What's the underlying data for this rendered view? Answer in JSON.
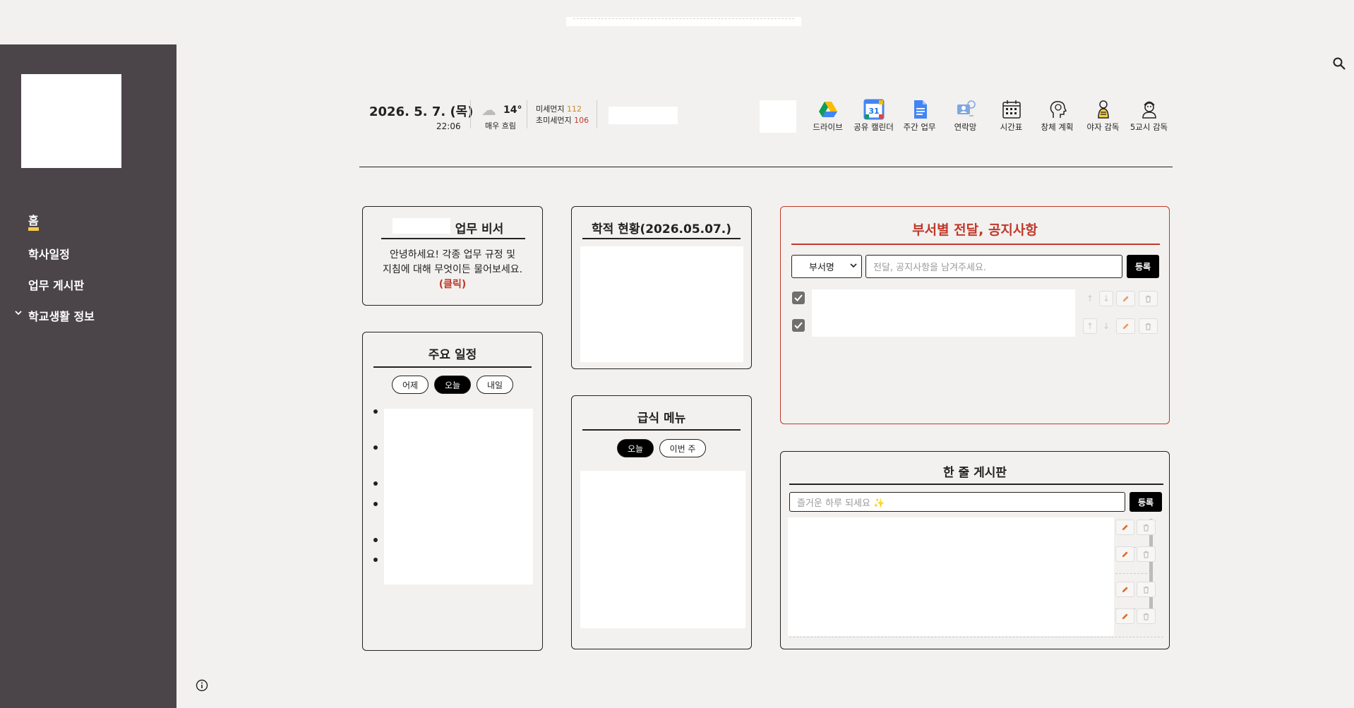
{
  "colors": {
    "sidebar": "#4b4549",
    "accent_yellow": "#f5cc4b",
    "notice_red": "#c0392b",
    "background": "#f2f1ef"
  },
  "sidebar": {
    "items": [
      {
        "label": "홈",
        "active": true
      },
      {
        "label": "학사일정"
      },
      {
        "label": "업무 게시판"
      },
      {
        "label": "학교생활 정보",
        "icon": "chevron-down-icon"
      }
    ]
  },
  "header": {
    "date": "2026. 5. 7. (목)",
    "time": "22:06",
    "weather": {
      "icon": "cloud-icon",
      "temp": "14°",
      "desc": "매우 흐림"
    },
    "dust": {
      "pm10_label": "미세먼지",
      "pm10_value": "112",
      "pm25_label": "초미세먼지",
      "pm25_value": "106"
    },
    "tools": [
      {
        "label": "드라이브",
        "icon": "google-drive-icon"
      },
      {
        "label": "공유 캘린더",
        "icon": "google-calendar-icon"
      },
      {
        "label": "주간 업무",
        "icon": "google-docs-icon"
      },
      {
        "label": "연락망",
        "icon": "contacts-icon"
      },
      {
        "label": "시간표",
        "icon": "timetable-icon"
      },
      {
        "label": "창체 계획",
        "icon": "brain-head-icon"
      },
      {
        "label": "야자 감독",
        "icon": "night-study-icon"
      },
      {
        "label": "5교시 감독",
        "icon": "supervisor-icon"
      }
    ],
    "calendar_number": "31"
  },
  "assistant": {
    "title": "업무 비서",
    "line1": "안녕하세요! 각종 업무 규정 및",
    "line2": "지침에 대해 무엇이든 물어보세요.",
    "link": "(클릭)"
  },
  "schedule": {
    "title": "주요 일정",
    "tabs": [
      {
        "label": "어제"
      },
      {
        "label": "오늘",
        "active": true
      },
      {
        "label": "내일"
      }
    ]
  },
  "enrollment": {
    "title": "학적 현황(2026.05.07.)"
  },
  "meal": {
    "title": "급식 메뉴",
    "tabs": [
      {
        "label": "오늘",
        "active": true
      },
      {
        "label": "이번 주"
      }
    ]
  },
  "notice": {
    "title": "부서별 전달, 공지사항",
    "select_value": "부서명",
    "input_placeholder": "전달, 공지사항을 남겨주세요.",
    "submit": "등록"
  },
  "oneline": {
    "title": "한 줄 게시판",
    "input_placeholder": "즐거운 하루 되세요 ✨",
    "submit": "등록"
  }
}
